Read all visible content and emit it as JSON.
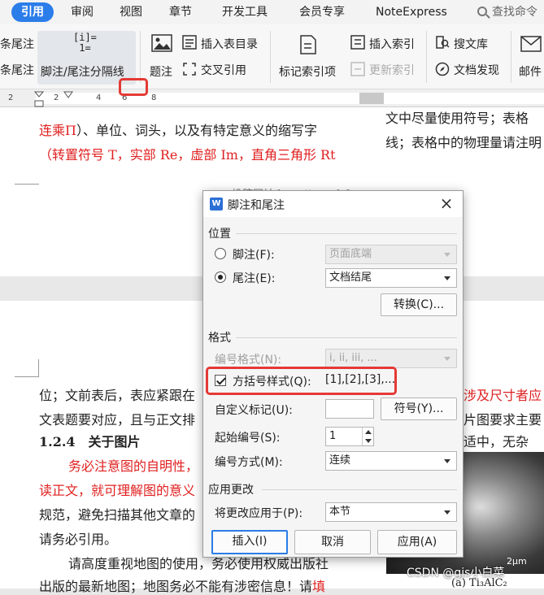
{
  "menu": {
    "items": [
      "引用",
      "审阅",
      "视图",
      "章节",
      "开发工具",
      "会员专享",
      "NoteExpress"
    ],
    "active_index": 0,
    "search_label": "查找命令"
  },
  "ribbon": {
    "endnote_1": "条尾注",
    "endnote_2": "条尾注",
    "separator_icon_text": "[i]=\n1=",
    "separator_label": "脚注/尾注分隔线",
    "caption": "题注",
    "insert_toc_table": "插入表目录",
    "cross_ref": "交叉引用",
    "mark_index": "标记索引项",
    "insert_index": "插入索引",
    "update_index": "更新索引",
    "search_lib": "搜文库",
    "doc_discover": "文档发现",
    "mail": "邮件"
  },
  "ruler": {
    "numbers": [
      "2",
      "2",
      "4",
      "6",
      "8"
    ]
  },
  "doc": {
    "top_line1_red": "连乘Π",
    "top_line1_rest": "）、单位、词头，以及有特定意义的缩写字",
    "top_line2": "（转置符号 T，实部 Re，虚部 Im，直角三角形 Rt",
    "right_line1": "文中尽量使用符号；表格",
    "right_line2": "线；表格中的物理量请注明",
    "url_text": "投稿网址 http://……zk/home",
    "line_a": "位；文前表后，表应紧跟在",
    "line_a_right_red": "涉及尺寸者应",
    "line_b": "文表题要对应，且与正文排",
    "line_b_right": "片图要求主要",
    "heading": "1.2.4　关于图片",
    "heading_right": "适中，无杂",
    "line_c_red": "务必注意图的自明性，",
    "line_d_red": "读正文，就可理解图的意义",
    "line_e": "规范，避免扫描其他文章的",
    "line_f": "请务必引用。",
    "line_g": "请高度重视地图的使用，务必使用权威出版社",
    "line_h": "出版的最新地图；地图务必不能有涉密信息！请",
    "line_h_red": "填",
    "image_scale": "2μm",
    "image_caption": "(a) Ti₃AlC₂",
    "watermark": "CSDN @gjs小白菜"
  },
  "dialog": {
    "title": "脚注和尾注",
    "close_glyph": "×",
    "position_group": "位置",
    "footnote_label": "脚注(F):",
    "footnote_value": "页面底端",
    "endnote_label": "尾注(E):",
    "endnote_value": "文档结尾",
    "convert_button": "转换(C)...",
    "format_group": "格式",
    "number_format_label": "编号格式(N):",
    "number_format_value": "i, ii, iii, ...",
    "bracket_label": "方括号样式(Q):",
    "bracket_value": "[1],[2],[3],...",
    "custom_mark_label": "自定义标记(U):",
    "custom_mark_value": "",
    "symbol_button": "符号(Y)...",
    "start_label": "起始编号(S):",
    "start_value": "1",
    "numbering_label": "编号方式(M):",
    "numbering_value": "连续",
    "apply_group": "应用更改",
    "apply_to_label": "将更改应用于(P):",
    "apply_to_value": "本节",
    "insert_button": "插入(I)",
    "cancel_button": "取消",
    "apply_button": "应用(A)"
  },
  "colors": {
    "accent": "#2b7de9",
    "highlight": "#e53935",
    "text_red": "#e02020"
  }
}
